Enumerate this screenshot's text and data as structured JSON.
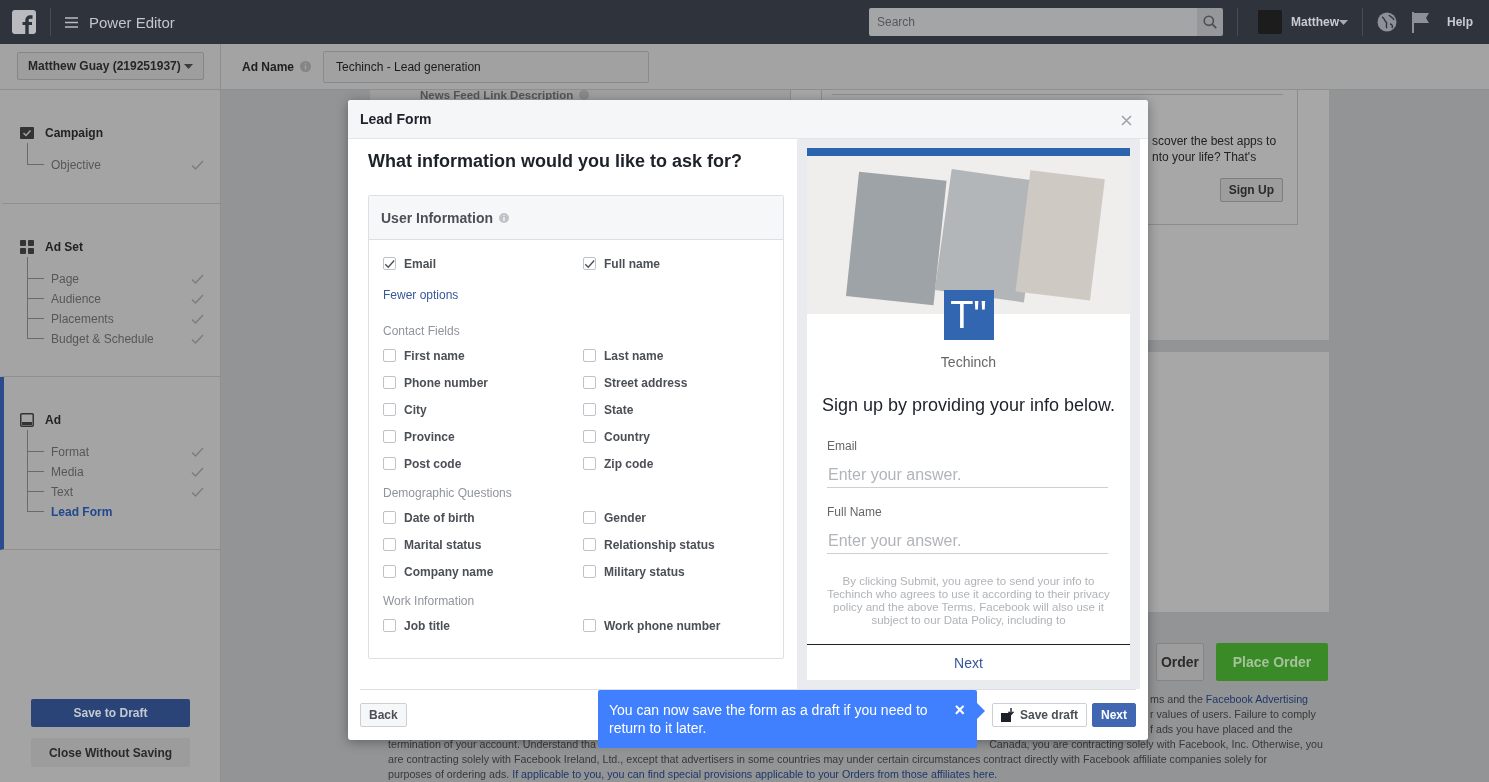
{
  "topbar": {
    "title": "Power Editor",
    "search": {
      "placeholder": "Search"
    },
    "user": "Matthew",
    "help": "Help"
  },
  "subheader": {
    "account": "Matthew Guay (219251937)",
    "ad_name": {
      "label": "Ad Name",
      "value": "Techinch - Lead generation"
    }
  },
  "sidebar": {
    "sections": [
      {
        "title": "Campaign",
        "active": false,
        "items": [
          {
            "label": "Objective",
            "done": true,
            "selected": false
          }
        ]
      },
      {
        "title": "Ad Set",
        "active": false,
        "items": [
          {
            "label": "Page",
            "done": true,
            "selected": false
          },
          {
            "label": "Audience",
            "done": true,
            "selected": false
          },
          {
            "label": "Placements",
            "done": true,
            "selected": false
          },
          {
            "label": "Budget & Schedule",
            "done": true,
            "selected": false
          }
        ]
      },
      {
        "title": "Ad",
        "active": true,
        "items": [
          {
            "label": "Format",
            "done": true,
            "selected": false
          },
          {
            "label": "Media",
            "done": true,
            "selected": false
          },
          {
            "label": "Text",
            "done": true,
            "selected": false
          },
          {
            "label": "Lead Form",
            "done": false,
            "selected": true
          }
        ]
      }
    ],
    "buttons": [
      {
        "label": "Save to Draft",
        "kind": "primary"
      },
      {
        "label": "Close Without Saving",
        "kind": "secondary"
      }
    ]
  },
  "background": {
    "field_label": "News Feed Link Description",
    "preview_lines": [
      "scover the best apps to",
      "nto your life? That's"
    ],
    "preview_button": "Sign Up",
    "order_buttons": [
      {
        "label": "Order",
        "kind": "secondary"
      },
      {
        "label": "Place Order",
        "kind": "primary"
      }
    ],
    "legal": [
      {
        "fragments": [
          {
            "segments": [
              {
                "text": "ms and the ",
                "link": false
              },
              {
                "text": "Facebook Advertising",
                "link": true
              }
            ]
          }
        ]
      },
      {
        "fragments": [
          {
            "segments": [
              {
                "text": "r values of users. Failure to comply",
                "link": false
              }
            ]
          }
        ]
      },
      {
        "fragments": [
          {
            "segments": [
              {
                "text": "f ads you have placed and the",
                "link": false
              }
            ]
          }
        ]
      },
      {
        "fragments": [
          {
            "segments": [
              {
                "text": "termination of your account. Understand tha",
                "link": false
              }
            ]
          },
          {
            "segments": [
              {
                "text": "Canada, you are contracting solely with Facebook, Inc. Otherwise, you",
                "link": false
              }
            ]
          }
        ]
      },
      {
        "fragments": [
          {
            "segments": [
              {
                "text": "are contracting solely with Facebook Ireland, Ltd., except that advertisers in some countries may under certain circumstances contract directly with Facebook affiliate companies solely for",
                "link": false
              }
            ]
          }
        ]
      },
      {
        "fragments": [
          {
            "segments": [
              {
                "text": "purposes of ordering ads. ",
                "link": false
              },
              {
                "text": "If applicable to you, you can find special provisions applicable to your Orders from those affiliates here.",
                "link": true
              }
            ]
          }
        ]
      }
    ]
  },
  "lead_form": {
    "title": "Lead Form",
    "question": "What information would you like to ask for?",
    "section": {
      "title": "User Information",
      "fields": [
        {
          "label": "Email",
          "checked": true
        },
        {
          "label": "Full name",
          "checked": true
        }
      ],
      "toggle_link": "Fewer options",
      "groups": [
        {
          "title": "Contact Fields",
          "fields": [
            {
              "label": "First name",
              "checked": false
            },
            {
              "label": "Last name",
              "checked": false
            },
            {
              "label": "Phone number",
              "checked": false
            },
            {
              "label": "Street address",
              "checked": false
            },
            {
              "label": "City",
              "checked": false
            },
            {
              "label": "State",
              "checked": false
            },
            {
              "label": "Province",
              "checked": false
            },
            {
              "label": "Country",
              "checked": false
            },
            {
              "label": "Post code",
              "checked": false
            },
            {
              "label": "Zip code",
              "checked": false
            }
          ]
        },
        {
          "title": "Demographic Questions",
          "fields": [
            {
              "label": "Date of birth",
              "checked": false
            },
            {
              "label": "Gender",
              "checked": false
            },
            {
              "label": "Marital status",
              "checked": false
            },
            {
              "label": "Relationship status",
              "checked": false
            },
            {
              "label": "Company name",
              "checked": false
            },
            {
              "label": "Military status",
              "checked": false
            }
          ]
        },
        {
          "title": "Work Information",
          "fields": [
            {
              "label": "Job title",
              "checked": false
            },
            {
              "label": "Work phone number",
              "checked": false
            }
          ]
        }
      ]
    },
    "preview": {
      "logo_text": "T\"",
      "page_name": "Techinch",
      "heading": "Sign up by providing your info below.",
      "fields": [
        {
          "label": "Email",
          "placeholder": "Enter your answer."
        },
        {
          "label": "Full Name",
          "placeholder": "Enter your answer."
        }
      ],
      "disclaimer": "By clicking Submit, you agree to send your info to Techinch who agrees to use it according to their privacy policy and the above Terms. Facebook will also use it subject to our Data Policy, including to",
      "button": "Next"
    },
    "footer": {
      "back": "Back",
      "save_draft": "Save draft",
      "next": "Next"
    }
  },
  "tooltip": {
    "text": "You can now save the form as a draft if you need to return to it later.",
    "close": "×"
  }
}
